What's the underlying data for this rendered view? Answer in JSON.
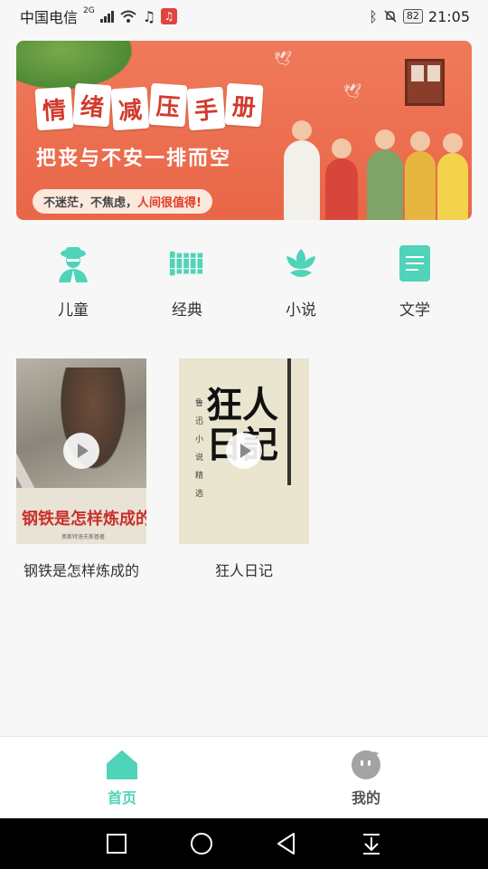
{
  "status_bar": {
    "carrier": "中国电信",
    "network": "2G",
    "time": "21:05",
    "battery": "82"
  },
  "banner": {
    "title_chars": [
      "情",
      "绪",
      "减",
      "压",
      "手",
      "册"
    ],
    "subtitle": "把丧与不安一排而空",
    "pill_text": "不迷茫，不焦虑，",
    "pill_highlight": "人间很值得!"
  },
  "categories": [
    {
      "label": "儿童",
      "icon": "child-icon"
    },
    {
      "label": "经典",
      "icon": "bamboo-scroll-icon"
    },
    {
      "label": "小说",
      "icon": "lotus-icon"
    },
    {
      "label": "文学",
      "icon": "document-icon"
    }
  ],
  "books": [
    {
      "title": "钢铁是怎样炼成的",
      "cover_title": "钢铁是怎样炼成的",
      "cover_small": "奥斯特洛夫斯基著"
    },
    {
      "title": "狂人日记",
      "cover_brush": "狂人日記",
      "cover_vertical": "鲁迅小说精选"
    }
  ],
  "tabbar": {
    "home_label": "首页",
    "mine_label": "我的"
  },
  "colors": {
    "accent": "#4fd3b9",
    "banner": "#eb6f50"
  }
}
